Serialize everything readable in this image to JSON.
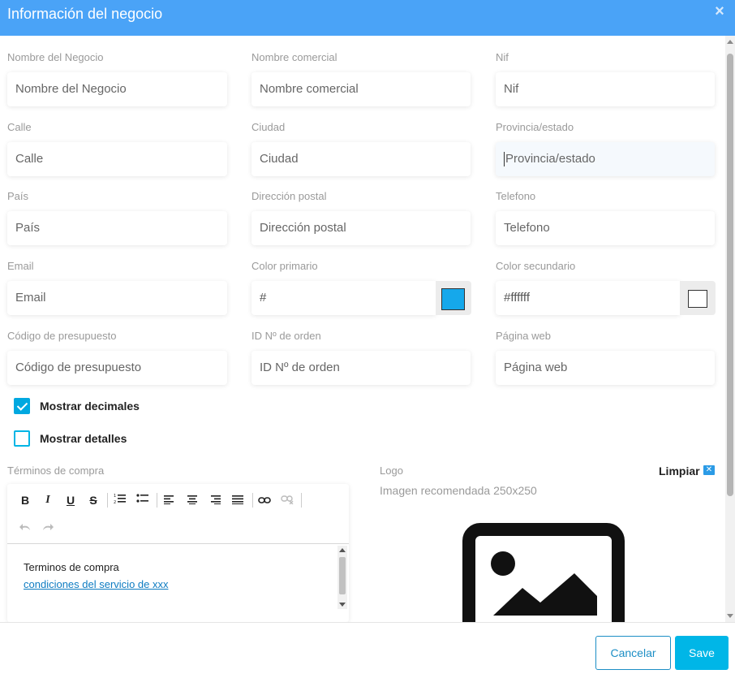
{
  "modal": {
    "title": "Información del negocio",
    "close_symbol": "×"
  },
  "fields": {
    "business_name": {
      "label": "Nombre del Negocio",
      "placeholder": "Nombre del Negocio"
    },
    "trade_name": {
      "label": "Nombre comercial",
      "placeholder": "Nombre comercial"
    },
    "nif": {
      "label": "Nif",
      "placeholder": "Nif"
    },
    "street": {
      "label": "Calle",
      "placeholder": "Calle"
    },
    "city": {
      "label": "Ciudad",
      "placeholder": "Ciudad"
    },
    "province": {
      "label": "Provincia/estado",
      "placeholder": "Provincia/estado"
    },
    "country": {
      "label": "País",
      "placeholder": "País"
    },
    "postal_address": {
      "label": "Dirección postal",
      "placeholder": "Dirección postal"
    },
    "phone": {
      "label": "Telefono",
      "placeholder": "Telefono"
    },
    "email": {
      "label": "Email",
      "placeholder": "Email"
    },
    "primary_color": {
      "label": "Color primario",
      "value": "#",
      "swatch": "#15a8eb"
    },
    "secondary_color": {
      "label": "Color secundario",
      "value": "#ffffff",
      "swatch": "#ffffff"
    },
    "budget_code": {
      "label": "Código de presupuesto",
      "placeholder": "Código de presupuesto"
    },
    "order_id": {
      "label": "ID Nº de orden",
      "placeholder": "ID Nº de orden"
    },
    "website": {
      "label": "Página web",
      "placeholder": "Página web"
    }
  },
  "options": {
    "show_decimals": {
      "label": "Mostrar decimales",
      "checked": true
    },
    "show_details": {
      "label": "Mostrar detalles",
      "checked": false
    }
  },
  "terms": {
    "label": "Términos de compra",
    "content_line": "Terminos de compra",
    "link_text": "condiciones del servicio de xxx"
  },
  "logo": {
    "label": "Logo",
    "clear_label": "Limpiar",
    "hint": "Imagen recomendada 250x250"
  },
  "footer": {
    "cancel_label": "Cancelar",
    "save_label": "Save"
  },
  "colors": {
    "header": "#4aa3f7",
    "accent": "#00b6e7",
    "link": "#0e7cc2"
  }
}
